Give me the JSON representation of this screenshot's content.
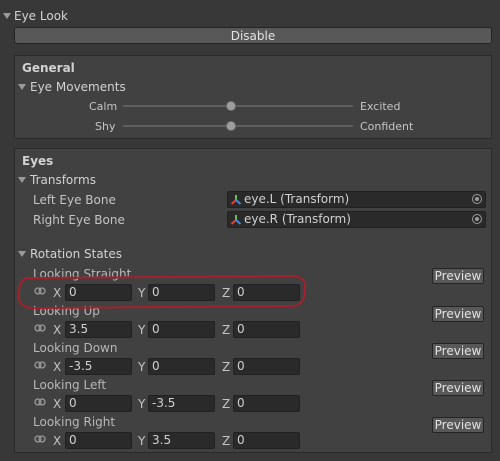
{
  "header": {
    "title": "Eye Look",
    "disable_label": "Disable"
  },
  "general": {
    "title": "General",
    "eye_movements": {
      "label": "Eye Movements",
      "sliders": [
        {
          "left": "Calm",
          "right": "Excited",
          "value": 0.47
        },
        {
          "left": "Shy",
          "right": "Confident",
          "value": 0.47
        }
      ]
    }
  },
  "eyes": {
    "title": "Eyes",
    "transforms": {
      "label": "Transforms",
      "fields": [
        {
          "label": "Left Eye Bone",
          "value": "eye.L (Transform)"
        },
        {
          "label": "Right Eye Bone",
          "value": "eye.R (Transform)"
        }
      ]
    },
    "rotation_states": {
      "label": "Rotation States",
      "preview_label": "Preview",
      "axes": [
        "X",
        "Y",
        "Z"
      ],
      "states": [
        {
          "name": "Looking Straight",
          "x": "0",
          "y": "0",
          "z": "0"
        },
        {
          "name": "Looking Up",
          "x": "3.5",
          "y": "0",
          "z": "0"
        },
        {
          "name": "Looking Down",
          "x": "-3.5",
          "y": "0",
          "z": "0"
        },
        {
          "name": "Looking Left",
          "x": "0",
          "y": "-3.5",
          "z": "0"
        },
        {
          "name": "Looking Right",
          "x": "0",
          "y": "3.5",
          "z": "0"
        }
      ]
    }
  },
  "colors": {
    "background": "#383838",
    "field_bg": "#2a2a2a",
    "button_bg": "#585858",
    "annotation": "#a3202c",
    "transform_icon_green": "#6cc04a",
    "transform_icon_red": "#e0443a",
    "transform_icon_blue": "#3d8af7"
  }
}
